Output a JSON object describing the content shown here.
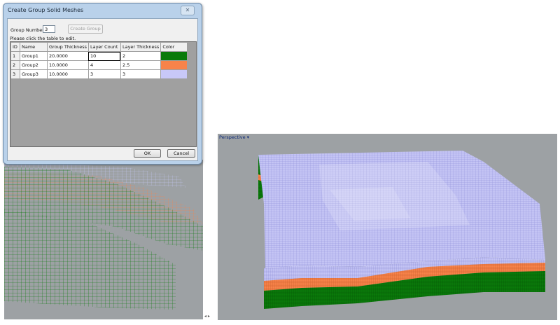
{
  "dialog": {
    "title": "Create Group Solid Meshes",
    "close_symbol": "✕",
    "group_number_label": "Group Number:",
    "group_number_value": "3",
    "create_group_label": "Create Group",
    "hint": "Please click the table to edit.",
    "ok_label": "OK",
    "cancel_label": "Cancel"
  },
  "table": {
    "headers": [
      "ID",
      "Name",
      "Group Thickness",
      "Layer Count",
      "Layer Thickness",
      "Color"
    ],
    "rows": [
      {
        "id": "1",
        "name": "Group1",
        "thickness": "20.0000",
        "count": "10",
        "layer_thickness": "2",
        "color": "#0a7a0a"
      },
      {
        "id": "2",
        "name": "Group2",
        "thickness": "10.0000",
        "count": "4",
        "layer_thickness": "2.5",
        "color": "#f7834a"
      },
      {
        "id": "3",
        "name": "Group3",
        "thickness": "10.0000",
        "count": "3",
        "layer_thickness": "3",
        "color": "#c8c8f8"
      }
    ]
  },
  "viewport_right": {
    "label": "Perspective",
    "menu_symbol": "▾"
  },
  "separator_symbol": "◂ ▸",
  "colors": {
    "dialog_frame": "#b9d1ea",
    "viewport_bg": "#9da1a4",
    "mesh_green": "#0a7a0a",
    "mesh_orange": "#f7834a",
    "mesh_lavender": "#c8c8f8"
  }
}
